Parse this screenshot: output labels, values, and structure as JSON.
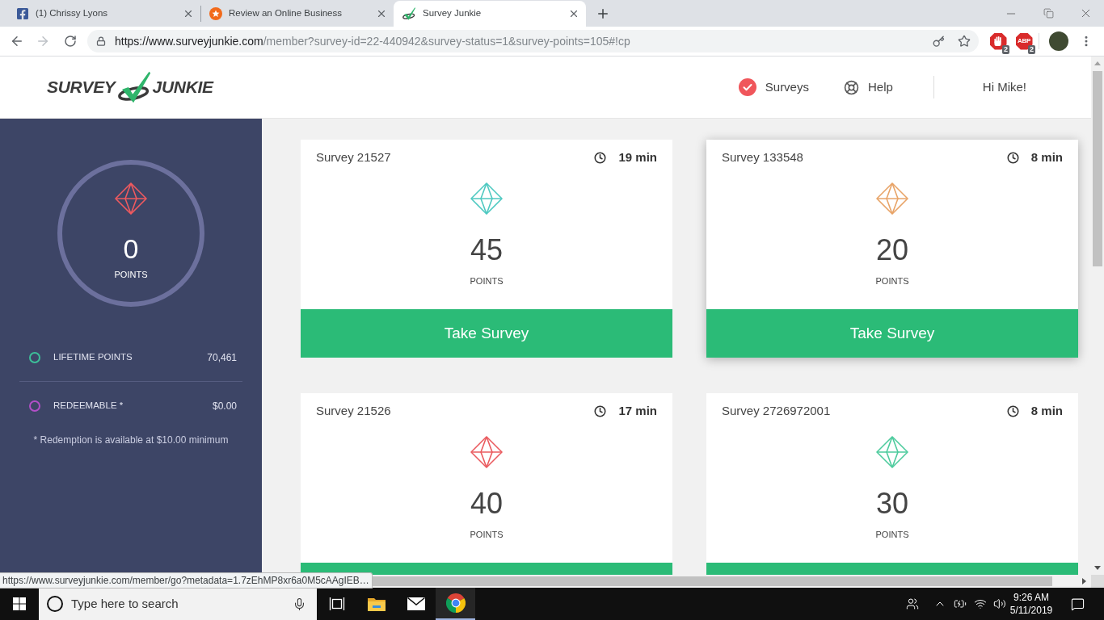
{
  "browser": {
    "tabs": [
      {
        "title": "(1) Chrissy Lyons",
        "kind": "facebook",
        "selected": false
      },
      {
        "title": "Review an Online Business",
        "kind": "review",
        "selected": false
      },
      {
        "title": "Survey Junkie",
        "kind": "surveyjunkie",
        "selected": true
      }
    ],
    "url": {
      "host": "https://www.surveyjunkie.com",
      "path": "/member?survey-id=22-440942&survey-status=1&survey-points=105#!cp"
    },
    "extensions": [
      {
        "kind": "stop-hand",
        "badge": "2"
      },
      {
        "kind": "abp",
        "label": "ABP",
        "badge": "2"
      }
    ]
  },
  "header": {
    "logo": {
      "left": "SURVEY",
      "right": "JUNKIE"
    },
    "nav": [
      {
        "kind": "surveys",
        "label": "Surveys"
      },
      {
        "kind": "help",
        "label": "Help"
      }
    ],
    "greeting": "Hi Mike!"
  },
  "sidebar": {
    "points": "0",
    "points_label": "POINTS",
    "stats": [
      {
        "label": "LIFETIME POINTS",
        "value": "70,461",
        "color": "#3dbf99"
      },
      {
        "label": "REDEEMABLE *",
        "value": "$0.00",
        "color": "#b24fc8"
      }
    ],
    "note": "* Redemption is available at $10.00 minimum"
  },
  "surveys": [
    {
      "title": "Survey 21527",
      "duration": "19 min",
      "color": "#4fc9c1",
      "points": "45",
      "points_label": "POINTS",
      "button": "Take Survey",
      "hovered": false
    },
    {
      "title": "Survey 133548",
      "duration": "8 min",
      "color": "#e8a468",
      "points": "20",
      "points_label": "POINTS",
      "button": "Take Survey",
      "hovered": true
    },
    {
      "title": "Survey 21526",
      "duration": "17 min",
      "color": "#ea5b5f",
      "points": "40",
      "points_label": "POINTS",
      "hovered": false
    },
    {
      "title": "Survey 2726972001",
      "duration": "8 min",
      "color": "#4dcb9d",
      "points": "30",
      "points_label": "POINTS",
      "hovered": false
    }
  ],
  "status_link": "https://www.surveyjunkie.com/member/go?metadata=1.7zEhMP8xr6a0M5cAAgIEB…",
  "taskbar": {
    "search": {
      "placeholder": "Type here to search"
    },
    "apps": [
      {
        "kind": "task-view",
        "selected": false
      },
      {
        "kind": "file-explorer",
        "selected": false
      },
      {
        "kind": "mail",
        "selected": false
      },
      {
        "kind": "chrome",
        "selected": true
      }
    ],
    "time": "9:26 AM",
    "date": "5/11/2019"
  }
}
